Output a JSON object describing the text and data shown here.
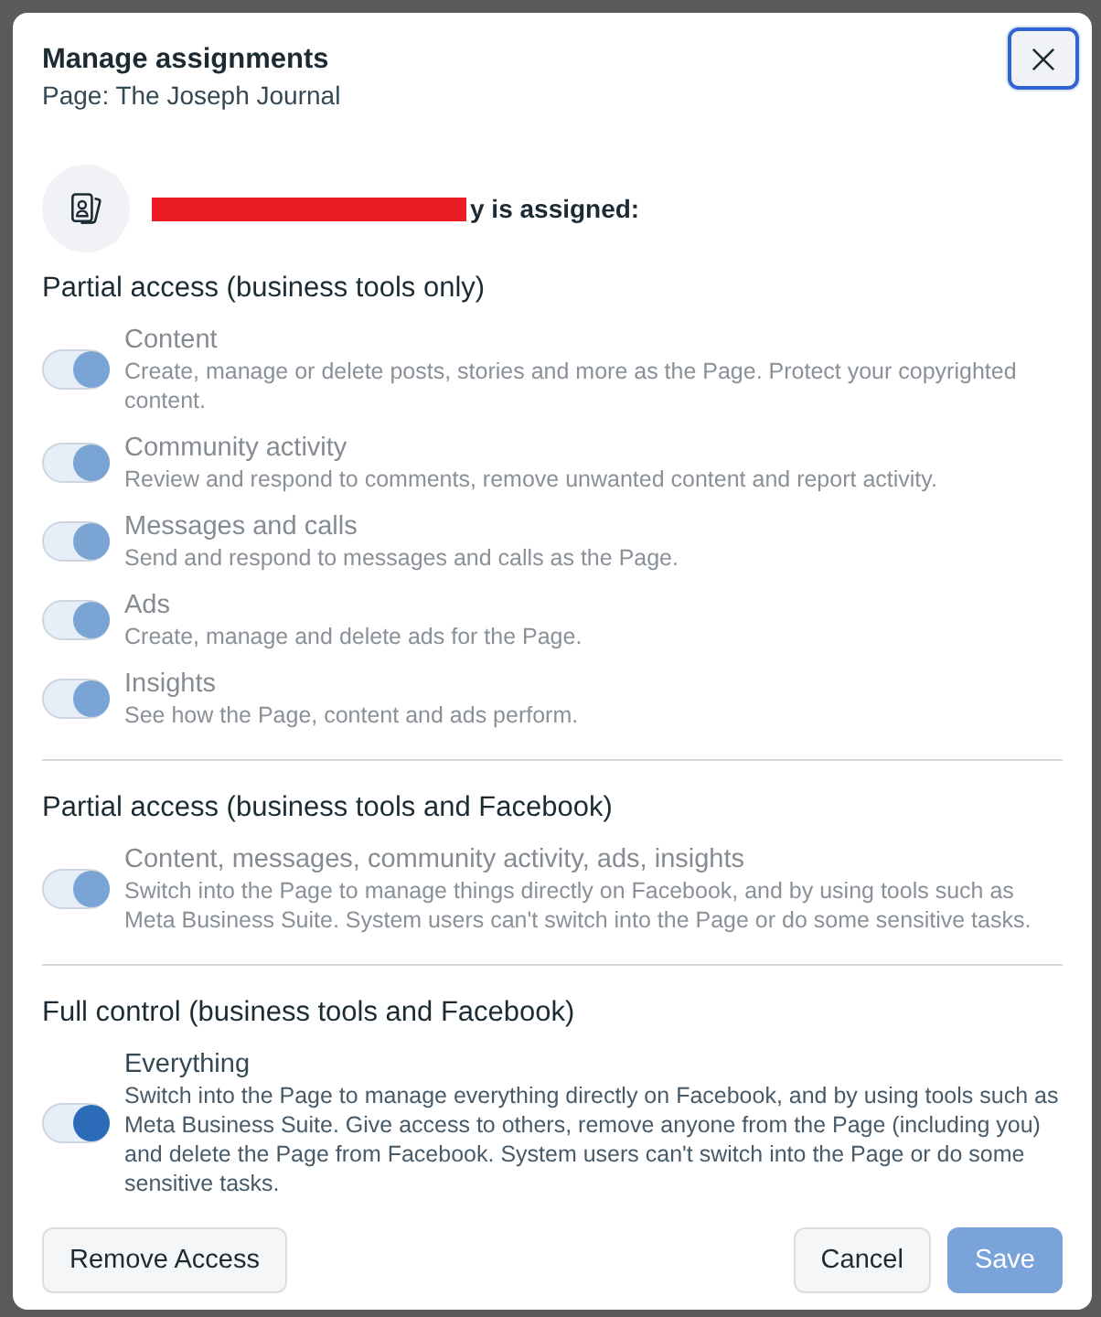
{
  "dialog": {
    "title": "Manage assignments",
    "subtitle": "Page: The Joseph Journal",
    "close_button": {
      "focused": true
    }
  },
  "assignment": {
    "redacted": true,
    "text": "y is assigned:"
  },
  "sections": [
    {
      "heading": "Partial access (business tools only)",
      "permissions": [
        {
          "label": "Content",
          "description": "Create, manage or delete posts, stories and more as the Page. Protect your copyrighted content.",
          "on": true,
          "disabled": true
        },
        {
          "label": "Community activity",
          "description": "Review and respond to comments, remove unwanted content and report activity.",
          "on": true,
          "disabled": true
        },
        {
          "label": "Messages and calls",
          "description": "Send and respond to messages and calls as the Page.",
          "on": true,
          "disabled": true
        },
        {
          "label": "Ads",
          "description": "Create, manage and delete ads for the Page.",
          "on": true,
          "disabled": true
        },
        {
          "label": "Insights",
          "description": "See how the Page, content and ads perform.",
          "on": true,
          "disabled": true
        }
      ]
    },
    {
      "heading": "Partial access (business tools and Facebook)",
      "permissions": [
        {
          "label": "Content, messages, community activity, ads, insights",
          "description": "Switch into the Page to manage things directly on Facebook, and by using tools such as Meta Business Suite. System users can't switch into the Page or do some sensitive tasks.",
          "on": true,
          "disabled": true
        }
      ]
    },
    {
      "heading": "Full control (business tools and Facebook)",
      "permissions": [
        {
          "label": "Everything",
          "description": "Switch into the Page to manage everything directly on Facebook, and by using tools such as Meta Business Suite. Give access to others, remove anyone from the Page (including you) and delete the Page from Facebook. System users can't switch into the Page or do some sensitive tasks.",
          "on": true,
          "disabled": false
        }
      ]
    }
  ],
  "footer": {
    "start_buttons": [
      {
        "label": "Remove Access",
        "kind": "secondary",
        "disabled": false
      }
    ],
    "end_buttons": [
      {
        "label": "Cancel",
        "kind": "secondary",
        "disabled": false
      },
      {
        "label": "Save",
        "kind": "primary",
        "disabled": true
      }
    ]
  }
}
